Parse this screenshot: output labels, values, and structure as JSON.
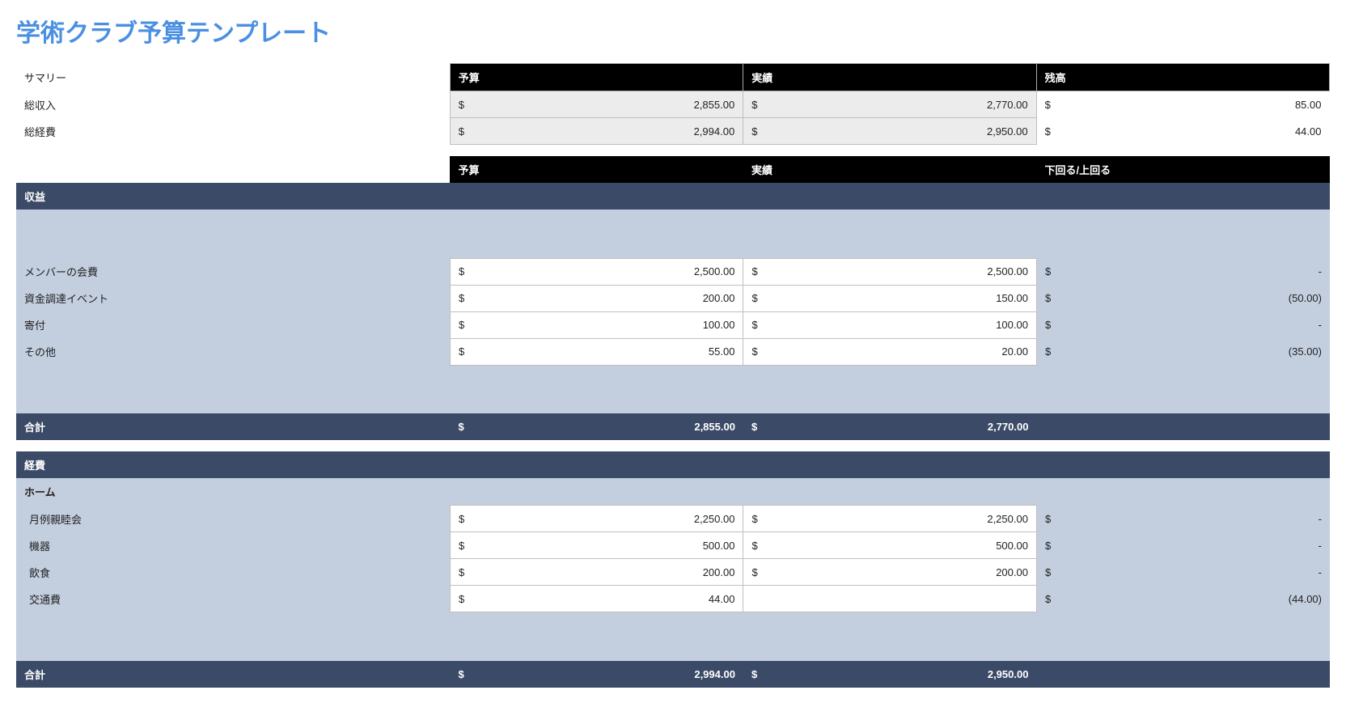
{
  "title": "学術クラブ予算テンプレート",
  "currency": "$",
  "dash": "-",
  "summary": {
    "label": "サマリー",
    "headers": {
      "budget": "予算",
      "actual": "実績",
      "balance": "残高"
    },
    "rows": [
      {
        "label": "総収入",
        "budget": "2,855.00",
        "actual": "2,770.00",
        "balance": "85.00"
      },
      {
        "label": "総経費",
        "budget": "2,994.00",
        "actual": "2,950.00",
        "balance": "44.00"
      }
    ]
  },
  "detail_headers": {
    "budget": "予算",
    "actual": "実績",
    "diff": "下回る/上回る"
  },
  "revenue": {
    "title": "収益",
    "items": [
      {
        "label": "メンバーの会費",
        "budget": "2,500.00",
        "actual": "2,500.00",
        "diff": "-"
      },
      {
        "label": "資金調達イベント",
        "budget": "200.00",
        "actual": "150.00",
        "diff": "(50.00)"
      },
      {
        "label": "寄付",
        "budget": "100.00",
        "actual": "100.00",
        "diff": "-"
      },
      {
        "label": "その他",
        "budget": "55.00",
        "actual": "20.00",
        "diff": "(35.00)"
      }
    ],
    "total": {
      "label": "合計",
      "budget": "2,855.00",
      "actual": "2,770.00"
    }
  },
  "expenses": {
    "title": "経費",
    "sub": "ホーム",
    "items": [
      {
        "label": "月例親睦会",
        "budget": "2,250.00",
        "actual": "2,250.00",
        "diff": "-"
      },
      {
        "label": "機器",
        "budget": "500.00",
        "actual": "500.00",
        "diff": "-"
      },
      {
        "label": "飲食",
        "budget": "200.00",
        "actual": "200.00",
        "diff": "-"
      },
      {
        "label": "交通費",
        "budget": "44.00",
        "actual": "",
        "diff": "(44.00)"
      }
    ],
    "total": {
      "label": "合計",
      "budget": "2,994.00",
      "actual": "2,950.00"
    }
  }
}
